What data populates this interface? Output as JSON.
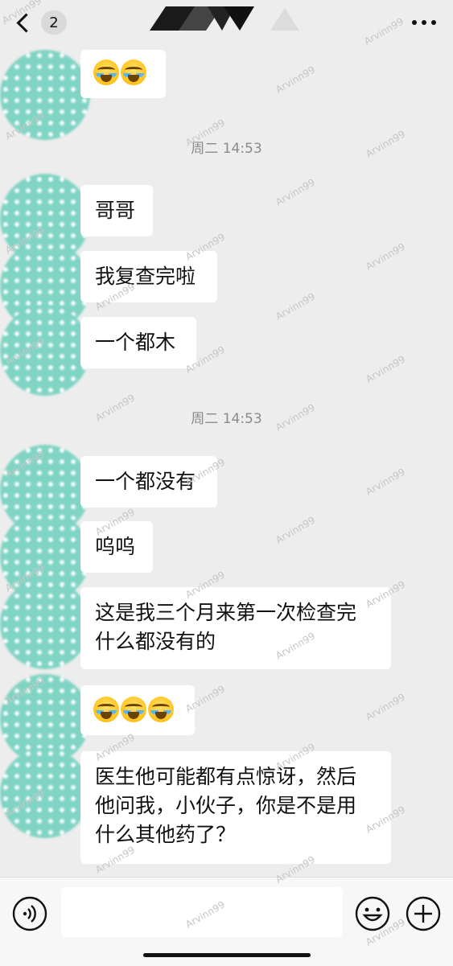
{
  "header": {
    "unread_count": "2"
  },
  "messages": [
    {
      "kind": "emoji",
      "emojis": [
        "loudly-crying-face",
        "loudly-crying-face"
      ]
    },
    {
      "kind": "time",
      "text": "周二 14:53"
    },
    {
      "kind": "text",
      "text": "哥哥"
    },
    {
      "kind": "text",
      "text": "我复查完啦"
    },
    {
      "kind": "text",
      "text": "一个都木"
    },
    {
      "kind": "time",
      "text": "周二 14:53"
    },
    {
      "kind": "text",
      "text": "一个都没有"
    },
    {
      "kind": "text",
      "text": "呜呜"
    },
    {
      "kind": "text",
      "lines": [
        "这是我三个月来第一次检查完",
        "什么都没有的"
      ]
    },
    {
      "kind": "emoji",
      "emojis": [
        "loudly-crying-face",
        "loudly-crying-face",
        "loudly-crying-face"
      ]
    },
    {
      "kind": "text",
      "lines": [
        "医生他可能都有点惊讶，然后",
        "他问我，小伙子，你是不是用",
        "什么其他药了？"
      ]
    }
  ],
  "watermark": "Arvinn99",
  "colors": {
    "background": "#ededed",
    "bubble": "#ffffff",
    "avatar_teal": "#7fd4c4",
    "timestamp": "#8a8a8a"
  }
}
